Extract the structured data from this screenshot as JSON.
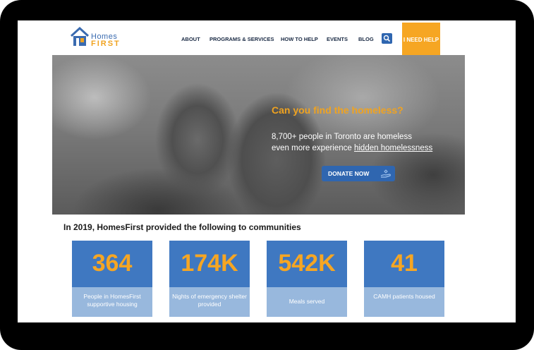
{
  "header": {
    "logo_homes": "Homes",
    "logo_first": "FIRST",
    "nav": [
      "ABOUT",
      "PROGRAMS & SERVICES",
      "HOW TO HELP",
      "EVENTS",
      "BLOG"
    ],
    "need_help_label": "I NEED HELP",
    "icons": {
      "search": "search-icon",
      "help": "hand-icon"
    }
  },
  "hero": {
    "question": "Can you find the homeless?",
    "line1": "8,700+ people in Toronto are homeless",
    "line2_prefix": "even more experience ",
    "line2_link": "hidden homelessness",
    "donate_label": "DONATE NOW"
  },
  "stats": {
    "title": "In 2019, HomesFirst provided the following to communities",
    "items": [
      {
        "value": "364",
        "label": "People in HomesFirst supportive housing"
      },
      {
        "value": "174K",
        "label": "Nights of emergency shelter provided"
      },
      {
        "value": "542K",
        "label": "Meals served"
      },
      {
        "value": "41",
        "label": "CAMH patients housed"
      }
    ]
  },
  "colors": {
    "accent_orange": "#f6a623",
    "brand_blue": "#3f78c1",
    "card_label_bg": "#98b8dd",
    "button_blue": "#2f66b0"
  }
}
